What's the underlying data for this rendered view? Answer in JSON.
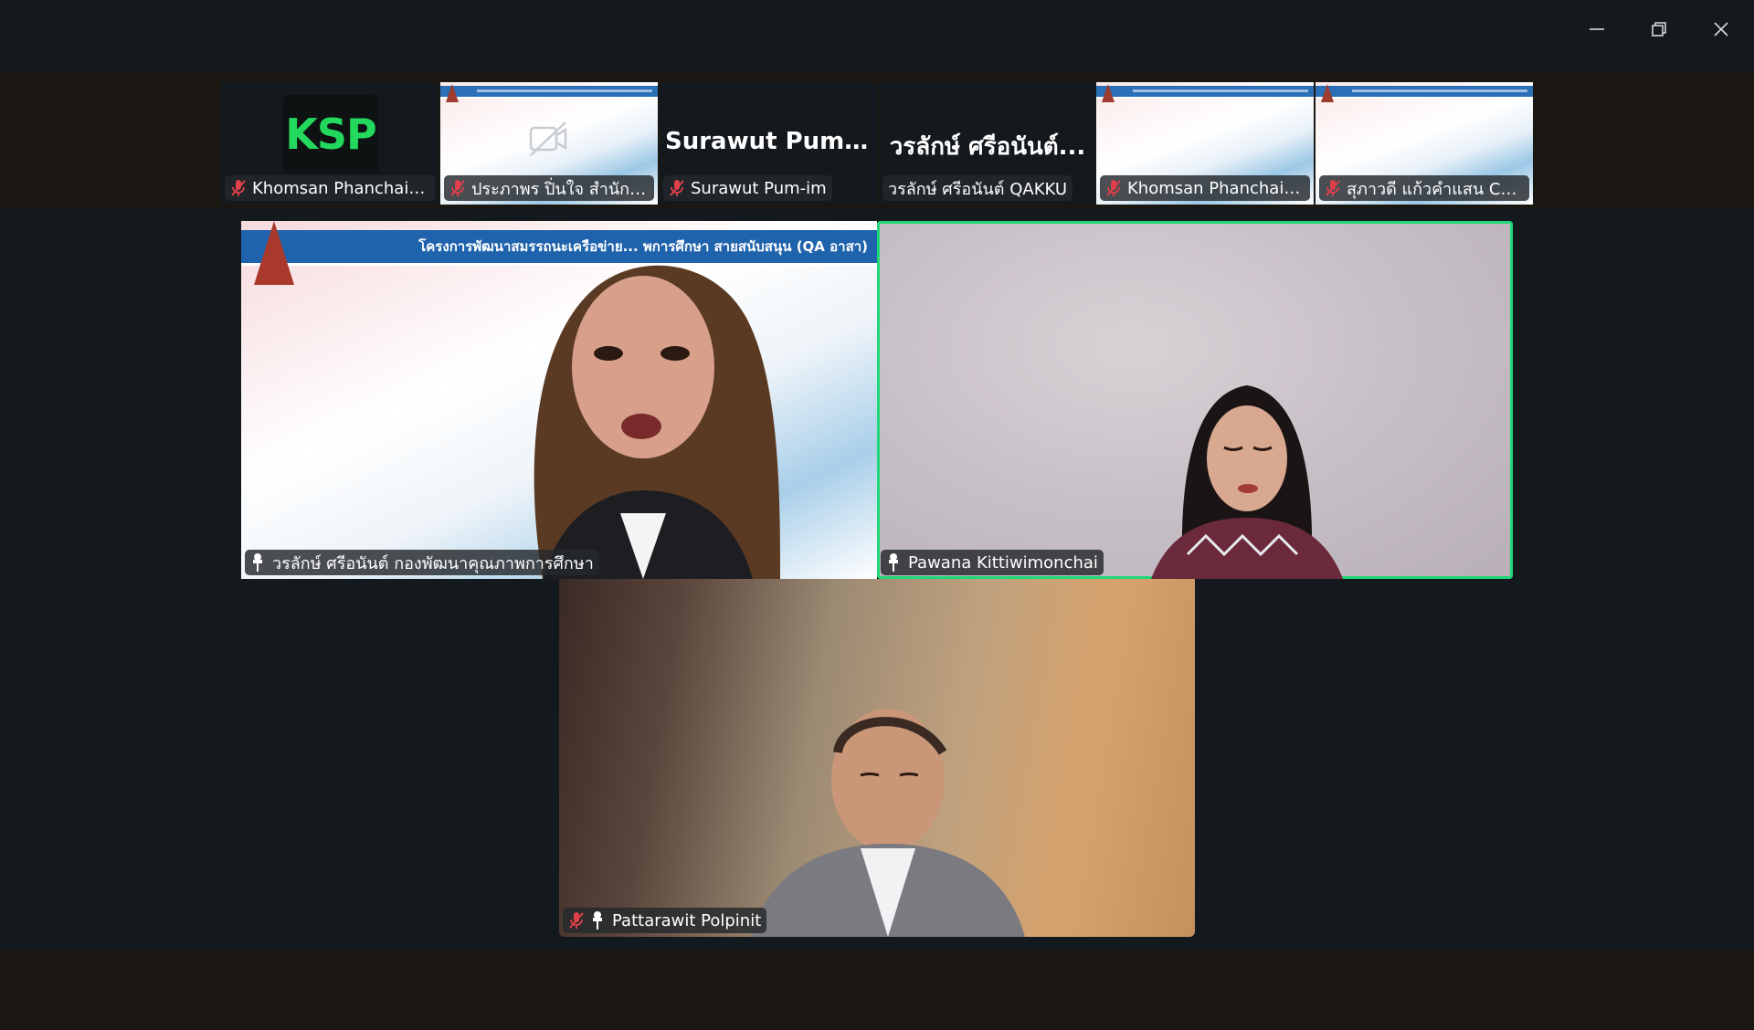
{
  "window": {
    "minimize_icon": "minimize-icon",
    "maximize_icon": "restore-icon",
    "close_icon": "close-icon"
  },
  "gallery_strip": [
    {
      "name": "Khomsan Phanchaiphet",
      "display": "KSP",
      "muted": true,
      "view": "logo"
    },
    {
      "name": "ประภาพร ปิ่นใจ สำนักบริก...",
      "muted": true,
      "view": "video-off-slide"
    },
    {
      "name": "Surawut Pum-im",
      "display": "Surawut Pum-im",
      "muted": true,
      "view": "name"
    },
    {
      "name": "วรลักษ์  ศรีอนันต์ QAKKU",
      "display": "วรลักษ์  ศรีอนันต์...",
      "muted": false,
      "view": "name"
    },
    {
      "name": "Khomsan Phanchaiphet",
      "muted": true,
      "view": "slide"
    },
    {
      "name": "สุภาวดี แก้วคำแสน COLA ...",
      "muted": true,
      "view": "slide"
    }
  ],
  "main_tiles": [
    {
      "name": "วรลักษ์  ศรีอนันต์  กองพัฒนาคุณภาพการศึกษา",
      "pinned": true,
      "muted": false,
      "banner": "โครงการพัฒนาสมรรถนะเครือข่าย...  พการศึกษา สายสนับสนุน (QA อาสา)"
    },
    {
      "name": "Pawana Kittiwimonchai",
      "pinned": true,
      "muted": false,
      "active_speaker": true
    },
    {
      "name": "Pattarawit Polpinit",
      "pinned": true,
      "muted": true
    }
  ],
  "colors": {
    "background": "#14191e",
    "active_speaker_border": "#20d878",
    "muted_icon": "#e0404a"
  }
}
